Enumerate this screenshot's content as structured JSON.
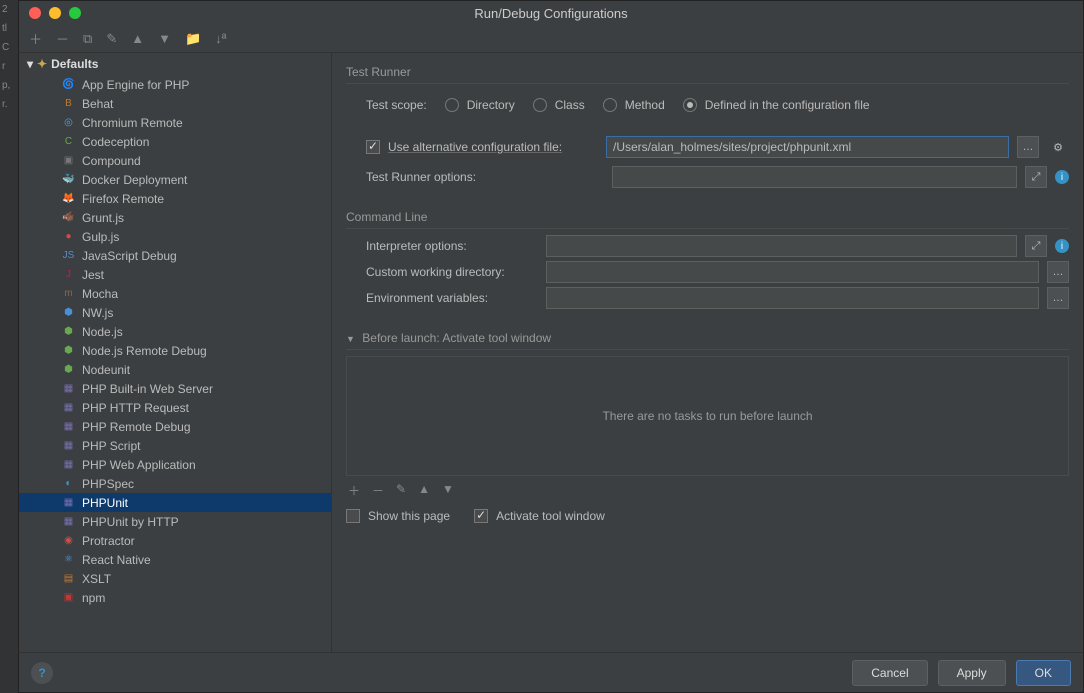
{
  "window": {
    "title": "Run/Debug Configurations"
  },
  "gutter": [
    "2",
    "tl",
    "C",
    "r",
    "p,",
    "r."
  ],
  "tree": {
    "root": "Defaults",
    "items": [
      {
        "label": "App Engine for PHP",
        "icon": "🌀",
        "color": "#3a9bdc"
      },
      {
        "label": "Behat",
        "icon": "B",
        "color": "#c27a2c"
      },
      {
        "label": "Chromium Remote",
        "icon": "◎",
        "color": "#4aa0e0"
      },
      {
        "label": "Codeception",
        "icon": "C",
        "color": "#6aa84f"
      },
      {
        "label": "Compound",
        "icon": "▣",
        "color": "#777"
      },
      {
        "label": "Docker Deployment",
        "icon": "🐳",
        "color": "#2496ed"
      },
      {
        "label": "Firefox Remote",
        "icon": "🦊",
        "color": "#e66000"
      },
      {
        "label": "Grunt.js",
        "icon": "🐗",
        "color": "#b98e4a"
      },
      {
        "label": "Gulp.js",
        "icon": "●",
        "color": "#d34a47"
      },
      {
        "label": "JavaScript Debug",
        "icon": "JS",
        "color": "#5a8ac6"
      },
      {
        "label": "Jest",
        "icon": "J",
        "color": "#c21f4a"
      },
      {
        "label": "Mocha",
        "icon": "m",
        "color": "#8d6748"
      },
      {
        "label": "NW.js",
        "icon": "⬢",
        "color": "#4a90d9"
      },
      {
        "label": "Node.js",
        "icon": "⬢",
        "color": "#6aa84f"
      },
      {
        "label": "Node.js Remote Debug",
        "icon": "⬢",
        "color": "#6aa84f"
      },
      {
        "label": "Nodeunit",
        "icon": "⬢",
        "color": "#6aa84f"
      },
      {
        "label": "PHP Built-in Web Server",
        "icon": "▦",
        "color": "#7a6fb0"
      },
      {
        "label": "PHP HTTP Request",
        "icon": "▦",
        "color": "#7a6fb0"
      },
      {
        "label": "PHP Remote Debug",
        "icon": "▦",
        "color": "#7a6fb0"
      },
      {
        "label": "PHP Script",
        "icon": "▦",
        "color": "#7a6fb0"
      },
      {
        "label": "PHP Web Application",
        "icon": "▦",
        "color": "#7a6fb0"
      },
      {
        "label": "PHPSpec",
        "icon": "◐",
        "color": "#3a9bdc"
      },
      {
        "label": "PHPUnit",
        "icon": "▦",
        "color": "#7a6fb0",
        "selected": true
      },
      {
        "label": "PHPUnit by HTTP",
        "icon": "▦",
        "color": "#7a6fb0"
      },
      {
        "label": "Protractor",
        "icon": "◉",
        "color": "#d34a47"
      },
      {
        "label": "React Native",
        "icon": "⚛",
        "color": "#4aa0e0"
      },
      {
        "label": "XSLT",
        "icon": "▤",
        "color": "#c27a2c"
      },
      {
        "label": "npm",
        "icon": "▣",
        "color": "#c53635"
      }
    ]
  },
  "testRunner": {
    "header": "Test Runner",
    "scopeLabel": "Test scope:",
    "scopes": [
      "Directory",
      "Class",
      "Method",
      "Defined in the configuration file"
    ],
    "selectedScope": 3,
    "useAltLabel": "Use alternative configuration file:",
    "useAltChecked": true,
    "altFilePath": "/Users/alan_holmes/sites/project/phpunit.xml",
    "optionsLabel": "Test Runner options:",
    "optionsValue": ""
  },
  "commandLine": {
    "header": "Command Line",
    "interpLabel": "Interpreter options:",
    "interpValue": "",
    "cwdLabel": "Custom working directory:",
    "cwdValue": "",
    "envLabel": "Environment variables:",
    "envValue": ""
  },
  "beforeLaunch": {
    "header": "Before launch: Activate tool window",
    "empty": "There are no tasks to run before launch",
    "showPage": "Show this page",
    "showPageChecked": false,
    "activateTool": "Activate tool window",
    "activateToolChecked": true
  },
  "footer": {
    "cancel": "Cancel",
    "apply": "Apply",
    "ok": "OK"
  }
}
